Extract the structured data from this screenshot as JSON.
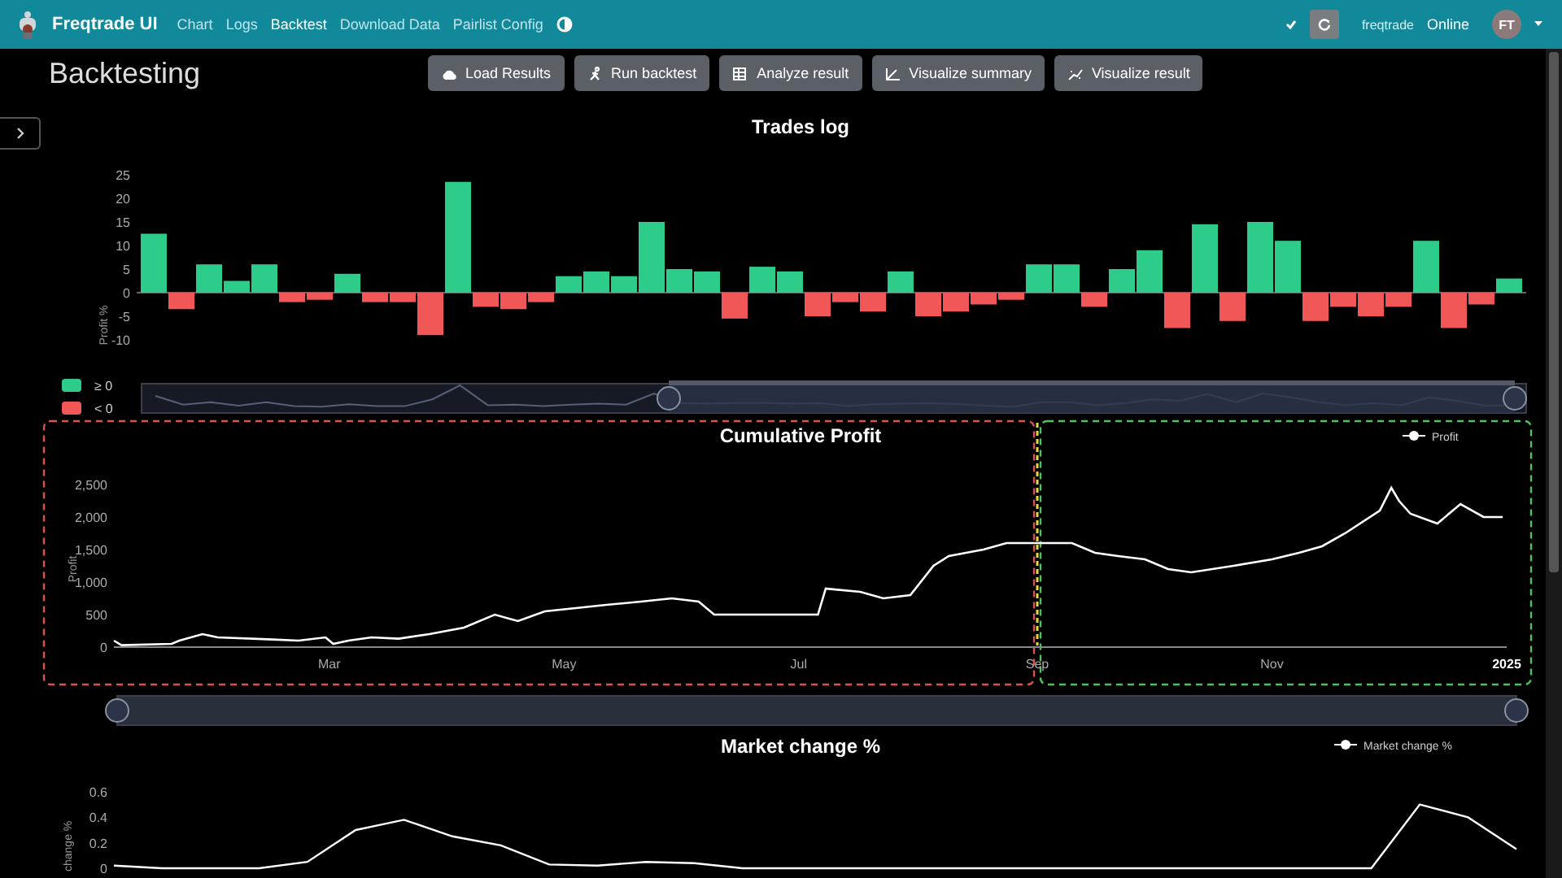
{
  "navbar": {
    "brand": "Freqtrade UI",
    "links": [
      {
        "label": "Chart",
        "selected": false
      },
      {
        "label": "Logs",
        "selected": false
      },
      {
        "label": "Backtest",
        "selected": true
      },
      {
        "label": "Download Data",
        "selected": false
      },
      {
        "label": "Pairlist Config",
        "selected": false
      }
    ],
    "bot_name": "freqtrade",
    "status": "Online",
    "avatar": "FT"
  },
  "page_title": "Backtesting",
  "actions": [
    {
      "label": "Load Results",
      "kind": "cloud"
    },
    {
      "label": "Run backtest",
      "kind": "run"
    },
    {
      "label": "Analyze result",
      "kind": "table"
    },
    {
      "label": "Visualize summary",
      "kind": "chart"
    },
    {
      "label": "Visualize result",
      "kind": "scatter"
    }
  ],
  "trades_log": {
    "legend": [
      {
        "label": "≥ 0",
        "color": "#2ecc8a"
      },
      {
        "label": "< 0",
        "color": "#f25757"
      }
    ],
    "chart_data": {
      "type": "bar",
      "title": "Trades log",
      "ylabel": "Profit %",
      "ylim": [
        -10,
        25
      ],
      "yticks": [
        {
          "value": -10,
          "label": "-10"
        },
        {
          "value": -5,
          "label": "-5"
        },
        {
          "value": 0,
          "label": "0"
        },
        {
          "value": 5,
          "label": "5"
        },
        {
          "value": 10,
          "label": "10"
        },
        {
          "value": 15,
          "label": "15"
        },
        {
          "value": 20,
          "label": "20"
        },
        {
          "value": 25,
          "label": "25"
        }
      ],
      "categories": [
        null,
        null,
        null,
        null,
        null,
        null,
        null,
        null,
        null,
        null,
        null,
        null,
        null,
        null,
        null,
        null,
        null,
        null,
        null,
        null,
        null,
        null,
        null,
        null,
        null,
        null,
        null,
        null,
        null,
        null,
        null,
        null,
        null,
        null,
        null,
        null,
        null,
        null,
        null,
        null,
        null,
        null,
        null,
        null,
        null,
        null,
        null,
        null,
        null,
        null
      ],
      "values": [
        12.5,
        -3.5,
        6,
        2.5,
        6,
        -2,
        -1.5,
        4,
        -2,
        -2,
        -9,
        23.5,
        -3,
        -3.5,
        -2,
        3.5,
        4.5,
        3.5,
        15,
        5,
        4.5,
        -5.5,
        5.5,
        4.5,
        -5,
        -2,
        -4,
        4.5,
        -5,
        -4,
        -2.5,
        -1.5,
        6,
        6,
        -3,
        5,
        9,
        -7.5,
        14.5,
        -6,
        15,
        11,
        -6,
        -3,
        -5,
        -3,
        11,
        -7.5,
        -2.5,
        3
      ]
    }
  },
  "cumulative_profit": {
    "regions": [
      {
        "color": "#d9534f"
      },
      {
        "color": "#4cc35b"
      }
    ],
    "chart_data": {
      "type": "line",
      "title": "Cumulative Profit",
      "ylabel": "Profit",
      "xlim": [
        "2024-01-05",
        "2025-01-01"
      ],
      "ylim": [
        0,
        2500
      ],
      "ref_lines": [
        {
          "axis": "x",
          "value": "2024-09-01",
          "color": "#e8d44d"
        }
      ],
      "xticks": [
        {
          "value": "2024-03-01",
          "label": "Mar"
        },
        {
          "value": "2024-05-01",
          "label": "May"
        },
        {
          "value": "2024-07-01",
          "label": "Jul"
        },
        {
          "value": "2024-09-01",
          "label": "Sep"
        },
        {
          "value": "2024-11-01",
          "label": "Nov"
        },
        {
          "value": "2025-01-01",
          "label": "2025"
        }
      ],
      "yticks": [
        {
          "value": 0,
          "label": "0"
        },
        {
          "value": 500,
          "label": "500"
        },
        {
          "value": 1000,
          "label": "1,000"
        },
        {
          "value": 1500,
          "label": "1,500"
        },
        {
          "value": 2000,
          "label": "2,000"
        },
        {
          "value": 2500,
          "label": "2,500"
        }
      ],
      "x": [
        "2024-01-05",
        "2024-01-07",
        "2024-01-20",
        "2024-01-22",
        "2024-01-28",
        "2024-02-01",
        "2024-02-14",
        "2024-02-22",
        "2024-02-29",
        "2024-03-02",
        "2024-03-06",
        "2024-03-12",
        "2024-03-19",
        "2024-03-27",
        "2024-04-05",
        "2024-04-13",
        "2024-04-19",
        "2024-04-26",
        "2024-05-04",
        "2024-05-12",
        "2024-05-21",
        "2024-05-29",
        "2024-06-05",
        "2024-06-09",
        "2024-07-06",
        "2024-07-08",
        "2024-07-17",
        "2024-07-23",
        "2024-07-30",
        "2024-08-05",
        "2024-08-09",
        "2024-08-18",
        "2024-08-24",
        "2024-09-10",
        "2024-09-16",
        "2024-09-22",
        "2024-09-29",
        "2024-10-05",
        "2024-10-11",
        "2024-10-22",
        "2024-11-01",
        "2024-11-08",
        "2024-11-14",
        "2024-11-20",
        "2024-11-29",
        "2024-12-02",
        "2024-12-04",
        "2024-12-07",
        "2024-12-14",
        "2024-12-20",
        "2024-12-26",
        "2024-12-31"
      ],
      "series": [
        {
          "name": "Profit",
          "color": "#ffffff",
          "values": [
            100,
            30,
            50,
            100,
            200,
            150,
            120,
            100,
            150,
            50,
            100,
            150,
            130,
            200,
            300,
            500,
            400,
            550,
            600,
            650,
            700,
            750,
            700,
            500,
            500,
            900,
            850,
            750,
            800,
            1250,
            1400,
            1500,
            1600,
            1600,
            1450,
            1400,
            1350,
            1200,
            1150,
            1250,
            1350,
            1450,
            1550,
            1750,
            2100,
            2450,
            2250,
            2050,
            1900,
            2200,
            2000,
            2000
          ]
        }
      ]
    }
  },
  "market_change": {
    "title": "Market change %",
    "chart_data": {
      "type": "line",
      "ylabel": "change %",
      "ylim": [
        0,
        0.6
      ],
      "yticks": [
        {
          "value": 0,
          "label": "0"
        },
        {
          "value": 0.2,
          "label": "0.2"
        },
        {
          "value": 0.4,
          "label": "0.4"
        },
        {
          "value": 0.6,
          "label": "0.6"
        }
      ],
      "categories": [
        null,
        null,
        null,
        null,
        null,
        null,
        null,
        null,
        null,
        null,
        null,
        null,
        null,
        null,
        null,
        null,
        null,
        null,
        null,
        null,
        null,
        null,
        null,
        null,
        null,
        null,
        null,
        null,
        null,
        null
      ],
      "series": [
        {
          "name": "Market change %",
          "color": "#ffffff",
          "values": [
            0.02,
            0,
            0,
            0,
            0.05,
            0.3,
            0.38,
            0.25,
            0.18,
            0.03,
            0.02,
            0.05,
            0.04,
            0,
            0,
            0,
            0,
            0,
            0,
            0,
            0,
            0,
            0,
            0,
            0,
            0,
            0,
            0.5,
            0.4,
            0.15
          ]
        }
      ]
    }
  }
}
